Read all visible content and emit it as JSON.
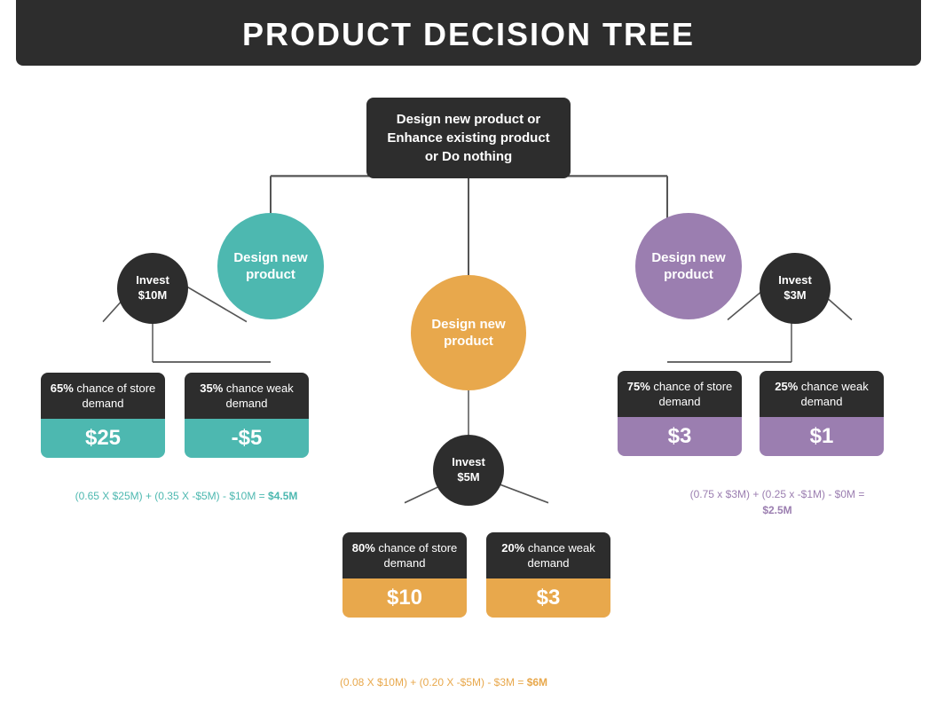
{
  "header": {
    "title": "PRODUCT DECISION TREE"
  },
  "root": {
    "label": "Design new product or Enhance existing product or Do nothing"
  },
  "nodes": {
    "teal_circle": "Design new\nproduct",
    "orange_circle": "Design new\nproduct",
    "purple_circle": "Design new\nproduct",
    "invest_10m": "Invest\n$10M",
    "invest_5m": "Invest\n$5M",
    "invest_3m": "Invest\n$3M"
  },
  "boxes": {
    "b65_top": "65% chance of store demand",
    "b65_pct": "65%",
    "b65_bottom": "$25",
    "b35_top": "35% chance weak demand",
    "b35_pct": "35%",
    "b35_bottom": "-$5",
    "b75_top": "75% chance of store demand",
    "b75_pct": "75%",
    "b75_bottom": "$3",
    "b25_top": "25% chance weak demand",
    "b25_pct": "25%",
    "b25_bottom": "$1",
    "b80_top": "80% chance of store demand",
    "b80_pct": "80%",
    "b80_bottom": "$10",
    "b20_top": "20% chance weak demand",
    "b20_pct": "20%",
    "b20_bottom": "$3"
  },
  "formulas": {
    "teal": "(0.65 X $25M) + (0.35 X -$5M) - $10M = $4.5M",
    "teal_result": "$4.5M",
    "purple": "(0.75 x $3M) + (0.25 x -$1M) - $0M =\n$2.5M",
    "purple_result": "$2.5M",
    "orange": "(0.08 X $10M) + (0.20 X -$5M) - $3M = $6M",
    "orange_result": "$6M"
  }
}
